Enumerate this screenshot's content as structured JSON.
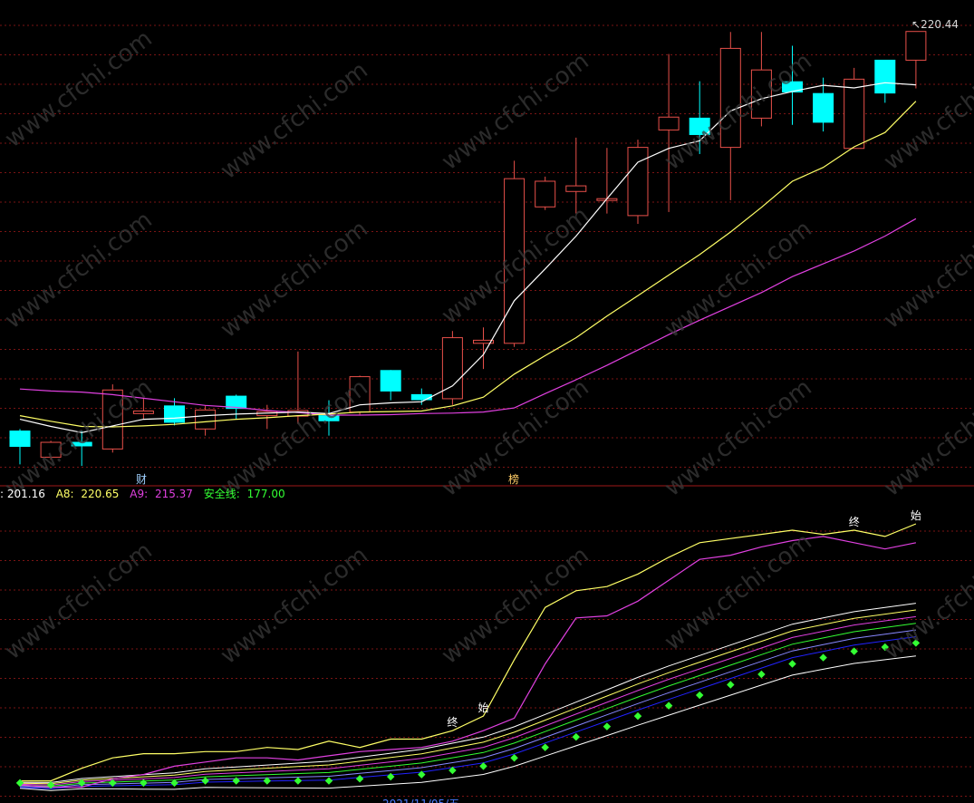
{
  "top_price_label": "220.44",
  "marker_finance": "财",
  "marker_list": "榜",
  "legend": {
    "a7": "201.16",
    "a8_label": "A8:",
    "a8": "220.65",
    "a9_label": "A9:",
    "a9": "215.37",
    "safety_label": "安全线:",
    "safety": "177.00"
  },
  "signal_start": "始",
  "signal_end": "终",
  "date_cut": "2021/11/05/五",
  "watermark": "www.cfchi.com",
  "colors": {
    "up": "#e8504a",
    "down": "#00ffff",
    "ma_white": "#ffffff",
    "ma_yellow": "#ffff66",
    "ma_magenta": "#e040e0",
    "safety": "#33ff33",
    "grid": "#7a1414"
  },
  "chart_data": [
    {
      "type": "candlestick",
      "title": "",
      "last_price": 220.44,
      "candles": [
        {
          "o": 142.5,
          "h": 142.9,
          "l": 136.0,
          "c": 139.5
        },
        {
          "o": 137.4,
          "h": 140.6,
          "l": 136.9,
          "c": 140.3
        },
        {
          "o": 140.3,
          "h": 142.5,
          "l": 135.7,
          "c": 139.6
        },
        {
          "o": 139.0,
          "h": 151.6,
          "l": 138.3,
          "c": 150.5
        },
        {
          "o": 145.9,
          "h": 149.0,
          "l": 144.9,
          "c": 146.4
        },
        {
          "o": 147.4,
          "h": 148.9,
          "l": 143.6,
          "c": 144.2
        },
        {
          "o": 142.9,
          "h": 147.5,
          "l": 141.6,
          "c": 146.6
        },
        {
          "o": 149.3,
          "h": 149.6,
          "l": 144.8,
          "c": 146.9
        },
        {
          "o": 145.5,
          "h": 147.6,
          "l": 142.9,
          "c": 146.3
        },
        {
          "o": 145.4,
          "h": 158.0,
          "l": 143.9,
          "c": 146.5
        },
        {
          "o": 145.5,
          "h": 148.5,
          "l": 141.6,
          "c": 144.5
        },
        {
          "o": 146.2,
          "h": 153.3,
          "l": 145.7,
          "c": 153.1
        },
        {
          "o": 154.3,
          "h": 154.4,
          "l": 148.5,
          "c": 150.3
        },
        {
          "o": 149.6,
          "h": 150.8,
          "l": 147.6,
          "c": 148.6
        },
        {
          "o": 148.8,
          "h": 162.0,
          "l": 147.6,
          "c": 160.7
        },
        {
          "o": 159.6,
          "h": 162.7,
          "l": 154.6,
          "c": 160.2
        },
        {
          "o": 159.6,
          "h": 195.2,
          "l": 158.9,
          "c": 191.7
        },
        {
          "o": 186.2,
          "h": 192.1,
          "l": 185.6,
          "c": 191.2
        },
        {
          "o": 189.2,
          "h": 199.7,
          "l": 184.9,
          "c": 190.3
        },
        {
          "o": 187.5,
          "h": 197.7,
          "l": 184.9,
          "c": 187.8
        },
        {
          "o": 184.5,
          "h": 199.3,
          "l": 182.9,
          "c": 197.8
        },
        {
          "o": 201.2,
          "h": 216.0,
          "l": 185.2,
          "c": 203.7
        },
        {
          "o": 203.5,
          "h": 210.7,
          "l": 196.5,
          "c": 200.3
        },
        {
          "o": 197.8,
          "h": 220.3,
          "l": 187.5,
          "c": 217.1
        },
        {
          "o": 203.5,
          "h": 220.3,
          "l": 201.9,
          "c": 212.9
        },
        {
          "o": 210.6,
          "h": 217.6,
          "l": 202.2,
          "c": 208.6
        },
        {
          "o": 208.3,
          "h": 211.4,
          "l": 200.9,
          "c": 202.7
        },
        {
          "o": 197.6,
          "h": 213.3,
          "l": 197.6,
          "c": 211.1
        },
        {
          "o": 214.8,
          "h": 214.8,
          "l": 206.5,
          "c": 208.4
        },
        {
          "o": 214.8,
          "h": 218.6,
          "l": 209.3,
          "c": 220.4
        }
      ],
      "ma_short": [
        144.8,
        143.4,
        142.2,
        143.5,
        144.8,
        145.0,
        145.5,
        145.8,
        146.0,
        146.2,
        145.9,
        147.6,
        148.0,
        148.2,
        151.3,
        157.4,
        167.9,
        174.1,
        180.5,
        187.8,
        194.9,
        197.6,
        199.1,
        204.9,
        207.3,
        208.7,
        209.9,
        209.4,
        210.4,
        210.0
      ],
      "ma_mid": [
        145.5,
        144.4,
        143.4,
        143.3,
        143.5,
        143.8,
        144.3,
        144.8,
        145.1,
        145.5,
        145.8,
        146.2,
        146.3,
        146.4,
        147.4,
        149.1,
        153.6,
        157.2,
        160.7,
        164.9,
        168.9,
        172.9,
        176.9,
        181.3,
        186.1,
        191.2,
        193.9,
        197.9,
        200.7,
        206.8
      ],
      "ma_long": [
        150.7,
        150.3,
        150.1,
        149.6,
        148.9,
        148.2,
        147.5,
        147.1,
        146.5,
        146.1,
        145.6,
        145.6,
        145.7,
        145.9,
        146.0,
        146.2,
        147.0,
        149.8,
        152.5,
        155.3,
        158.3,
        161.3,
        164.1,
        166.8,
        169.5,
        172.6,
        175.1,
        177.6,
        180.5,
        183.9
      ]
    },
    {
      "type": "line",
      "title": "",
      "series": [
        {
          "name": "A8",
          "values": [
            2,
            2,
            8,
            13,
            15,
            15,
            16,
            16,
            18,
            17,
            21,
            18,
            22,
            22,
            26,
            33,
            60,
            85,
            93,
            95,
            101,
            109,
            116,
            118,
            120,
            122,
            120,
            122,
            119,
            125
          ]
        },
        {
          "name": "A9",
          "values": [
            0,
            -1,
            -1,
            3,
            5,
            9,
            11,
            13,
            13,
            12,
            14,
            16,
            17,
            18,
            21,
            26,
            32,
            58,
            80,
            81,
            88,
            98,
            108,
            110,
            114,
            117,
            119,
            116,
            113,
            116
          ]
        },
        {
          "name": "安全线",
          "values": [
            1,
            0,
            1,
            1,
            1,
            1,
            2,
            2,
            2,
            2,
            2,
            3,
            4,
            5,
            7,
            9,
            13,
            18,
            23,
            28,
            33,
            38,
            43,
            48,
            53,
            58,
            61,
            64,
            66,
            68
          ]
        }
      ],
      "fan_lines": 7,
      "signals": [
        {
          "index": 14,
          "label": "终"
        },
        {
          "index": 15,
          "label": "始"
        },
        {
          "index": 27,
          "label": "终"
        },
        {
          "index": 29,
          "label": "始"
        }
      ]
    }
  ]
}
